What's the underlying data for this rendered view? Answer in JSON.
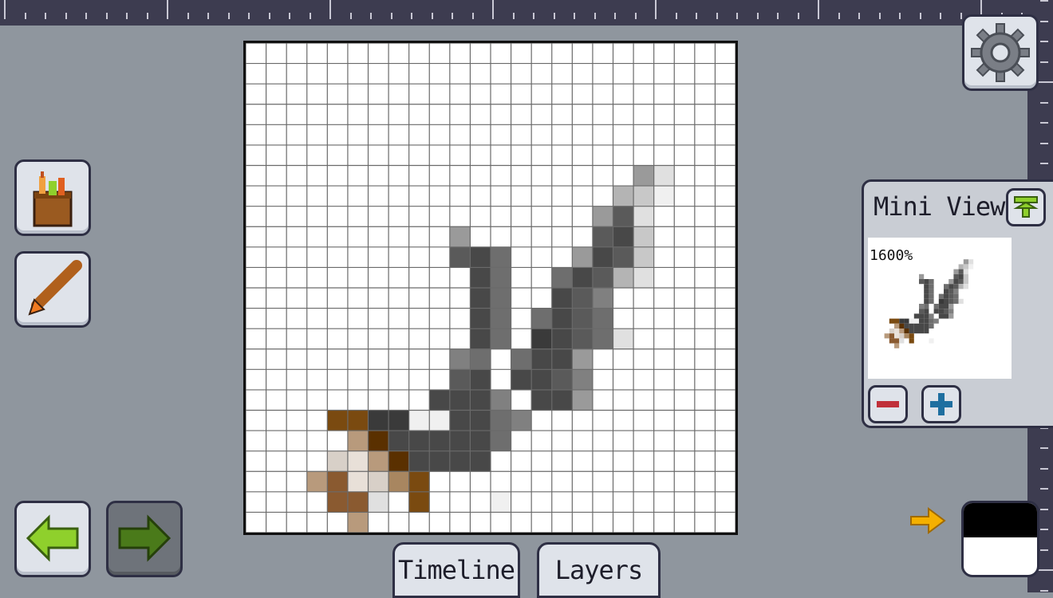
{
  "mini_view": {
    "title": "Mini View",
    "zoom": "1600%"
  },
  "tabs": {
    "timeline": "Timeline",
    "layers": "Layers"
  },
  "colors": {
    "background": "#8f969e",
    "ruler": "#3d3c50",
    "panel": "#dfe3ea",
    "accent_green": "#8fd02c",
    "accent_blue": "#1f6fa0",
    "accent_red": "#c0303a",
    "accent_orange": "#f0a800",
    "primary_color": "#000000",
    "secondary_color": "#ffffff"
  },
  "icons": {
    "settings": "gear-icon",
    "tools": "toolbox-icon",
    "brush": "brush-icon",
    "undo": "arrow-left-icon",
    "redo": "arrow-right-icon",
    "pin": "pin-icon",
    "zoom_out": "minus-icon",
    "zoom_in": "plus-icon",
    "swap": "arrow-right-icon"
  },
  "sprite": {
    "grid_size": 24,
    "palette": {
      "a": "#9a9a9a",
      "b": "#b4b4b4",
      "c": "#c8c8c8",
      "d": "#e0e0e0",
      "e": "#f0f0f0",
      "f": "#5a5a5a",
      "g": "#484848",
      "h": "#6e6e6e",
      "i": "#808080",
      "j": "#3a3a3a",
      "k": "#7a4a10",
      "l": "#5a3000",
      "m": "#8a5a30",
      "n": "#b89a7c",
      "o": "#d8d0c8",
      "p": "#e8e0d8",
      "q": "#a88660"
    },
    "rows": [
      "........................",
      "........................",
      "........................",
      "........................",
      "........................",
      "........................",
      "...................ad...",
      "..................bce...",
      ".................afd....",
      ".................fgc....",
      "................agfc....",
      "...............hgfbd....",
      "...............gfi......",
      "..............hgfh......",
      "..............jgfhd.....",
      ".............hgga.......",
      ".............ggfi.......",
      "..............gga.......",
      "..........................",
      "...........................",
      "........................",
      "........................",
      "........................",
      "........................"
    ],
    "extra": [
      [
        9,
        10,
        "a"
      ],
      [
        10,
        10,
        "f"
      ],
      [
        10,
        11,
        "g"
      ],
      [
        10,
        12,
        "h"
      ],
      [
        11,
        11,
        "g"
      ],
      [
        11,
        12,
        "h"
      ],
      [
        12,
        11,
        "g"
      ],
      [
        12,
        12,
        "h"
      ],
      [
        13,
        11,
        "g"
      ],
      [
        13,
        12,
        "h"
      ],
      [
        14,
        11,
        "g"
      ],
      [
        14,
        12,
        "h"
      ],
      [
        15,
        10,
        "i"
      ],
      [
        15,
        11,
        "h"
      ],
      [
        16,
        10,
        "f"
      ],
      [
        16,
        11,
        "g"
      ],
      [
        17,
        9,
        "g"
      ],
      [
        17,
        10,
        "g"
      ],
      [
        17,
        11,
        "g"
      ],
      [
        17,
        12,
        "i"
      ],
      [
        18,
        4,
        "k"
      ],
      [
        18,
        5,
        "k"
      ],
      [
        18,
        6,
        "j"
      ],
      [
        18,
        7,
        "j"
      ],
      [
        18,
        8,
        "e"
      ],
      [
        18,
        9,
        "e"
      ],
      [
        18,
        10,
        "g"
      ],
      [
        18,
        11,
        "g"
      ],
      [
        18,
        12,
        "h"
      ],
      [
        18,
        13,
        "i"
      ],
      [
        19,
        5,
        "n"
      ],
      [
        19,
        6,
        "l"
      ],
      [
        19,
        7,
        "g"
      ],
      [
        19,
        8,
        "g"
      ],
      [
        19,
        9,
        "g"
      ],
      [
        19,
        10,
        "g"
      ],
      [
        19,
        11,
        "g"
      ],
      [
        19,
        12,
        "h"
      ],
      [
        20,
        4,
        "o"
      ],
      [
        20,
        5,
        "p"
      ],
      [
        20,
        6,
        "n"
      ],
      [
        20,
        7,
        "l"
      ],
      [
        20,
        8,
        "g"
      ],
      [
        20,
        9,
        "g"
      ],
      [
        20,
        10,
        "g"
      ],
      [
        20,
        11,
        "g"
      ],
      [
        21,
        3,
        "n"
      ],
      [
        21,
        4,
        "m"
      ],
      [
        21,
        5,
        "p"
      ],
      [
        21,
        6,
        "o"
      ],
      [
        21,
        7,
        "q"
      ],
      [
        21,
        8,
        "k"
      ],
      [
        22,
        4,
        "m"
      ],
      [
        22,
        5,
        "m"
      ],
      [
        22,
        6,
        "d"
      ],
      [
        22,
        8,
        "k"
      ],
      [
        22,
        12,
        "e"
      ],
      [
        23,
        5,
        "n"
      ]
    ]
  }
}
